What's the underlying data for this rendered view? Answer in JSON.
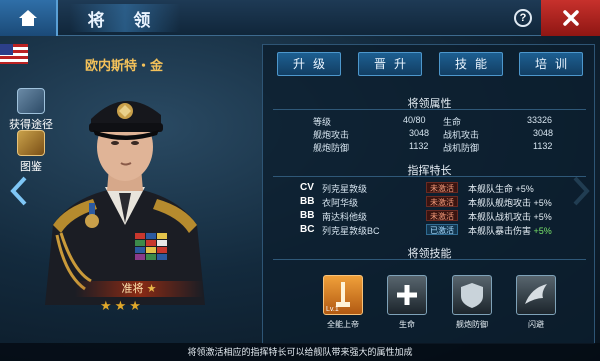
{
  "header": {
    "title": "将 领",
    "help_label": "?"
  },
  "commander": {
    "name": "欧内斯特・金",
    "rank": "准将",
    "stars": "★★★"
  },
  "side_buttons": [
    {
      "label": "获得途径"
    },
    {
      "label": "图鉴"
    }
  ],
  "tabs": [
    "升级",
    "晋升",
    "技能",
    "培训"
  ],
  "attributes": {
    "title": "将领属性",
    "rows": [
      [
        {
          "label": "等级",
          "value": "40/80"
        },
        {
          "label": "生命",
          "value": "33326"
        }
      ],
      [
        {
          "label": "舰炮攻击",
          "value": "3048"
        },
        {
          "label": "战机攻击",
          "value": "3048"
        }
      ],
      [
        {
          "label": "舰炮防御",
          "value": "1132"
        },
        {
          "label": "战机防御",
          "value": "1132"
        }
      ]
    ]
  },
  "specialties": {
    "title": "指挥特长",
    "items": [
      {
        "type": "CV",
        "ship": "列克星敦级",
        "status": "未激活",
        "desc": "本舰队生命",
        "bonus": "+5%",
        "active": false
      },
      {
        "type": "BB",
        "ship": "衣阿华级",
        "status": "未激活",
        "desc": "本舰队舰炮攻击",
        "bonus": "+5%",
        "active": false
      },
      {
        "type": "BB",
        "ship": "南达科他级",
        "status": "未激活",
        "desc": "本舰队战机攻击",
        "bonus": "+5%",
        "active": false
      },
      {
        "type": "BC",
        "ship": "列克星敦级BC",
        "status": "已激活",
        "desc": "本舰队暴击伤害",
        "bonus": "+5%",
        "active": true
      }
    ]
  },
  "skills": {
    "title": "将领技能",
    "items": [
      {
        "label": "全能上帝",
        "level": "Lv.1",
        "icon": "fleet-icon"
      },
      {
        "label": "生命",
        "level": "",
        "icon": "hp-icon"
      },
      {
        "label": "舰炮防御",
        "level": "",
        "icon": "gun-defense-icon"
      },
      {
        "label": "闪避",
        "level": "",
        "icon": "evade-icon"
      }
    ]
  },
  "footer_text": "将领激活相应的指挥特长可以给舰队带来强大的属性加成",
  "colors": {
    "accent_gold": "#f3c15a",
    "close_red": "#c7312c",
    "tab_blue": "#1d5f91",
    "positive_green": "#79e36b"
  }
}
